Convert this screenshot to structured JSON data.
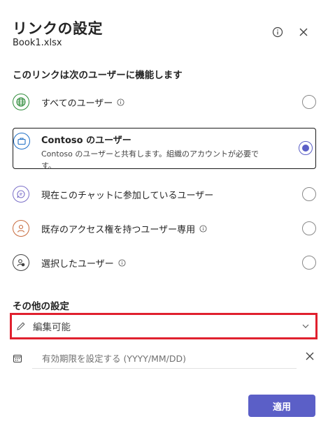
{
  "dialog": {
    "title": "リンクの設定",
    "file_name": "Book1.xlsx"
  },
  "audience": {
    "heading": "このリンクは次のユーザーに機能します",
    "options": [
      {
        "label": "すべてのユーザー",
        "icon": "globe-icon",
        "has_info": true,
        "selected": false
      },
      {
        "label": "Contoso のユーザー",
        "description": "Contoso のユーザーと共有します。組織のアカウントが必要です。",
        "icon": "briefcase-icon",
        "has_info": false,
        "selected": true
      },
      {
        "label": "現在このチャットに参加しているユーザー",
        "icon": "chat-icon",
        "has_info": false,
        "selected": false
      },
      {
        "label": "既存のアクセス権を持つユーザー専用",
        "icon": "person-icon",
        "has_info": true,
        "selected": false
      },
      {
        "label": "選択したユーザー",
        "icon": "people-icon",
        "has_info": true,
        "selected": false
      }
    ]
  },
  "other_settings": {
    "heading": "その他の設定",
    "permission_value": "編集可能",
    "expiry_placeholder": "有効期限を設定する (YYYY/MM/DD)"
  },
  "apply_label": "適用",
  "colors": {
    "accent": "#5b5fc7",
    "highlight_box": "#e0202e"
  }
}
